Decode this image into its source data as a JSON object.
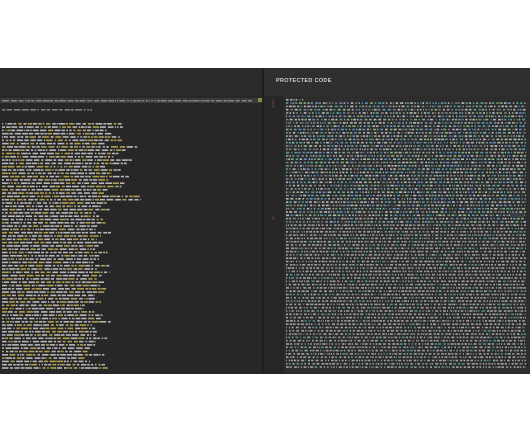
{
  "editor": {
    "right_pane_title": "PROTECTED CODE",
    "gutter_numbers": [
      "1",
      "2",
      "3"
    ]
  },
  "colors": {
    "window_bg": "#2b2b2b",
    "left_bg": "#272727",
    "right_bg": "#2d2d2d",
    "text_muted": "#8c8c8c",
    "text_yellow": "#c9b458",
    "text_light": "#d0d0d0",
    "text_cyan": "#5fb3b3",
    "text_blue": "#6ca0dc",
    "text_green": "#99c794"
  }
}
